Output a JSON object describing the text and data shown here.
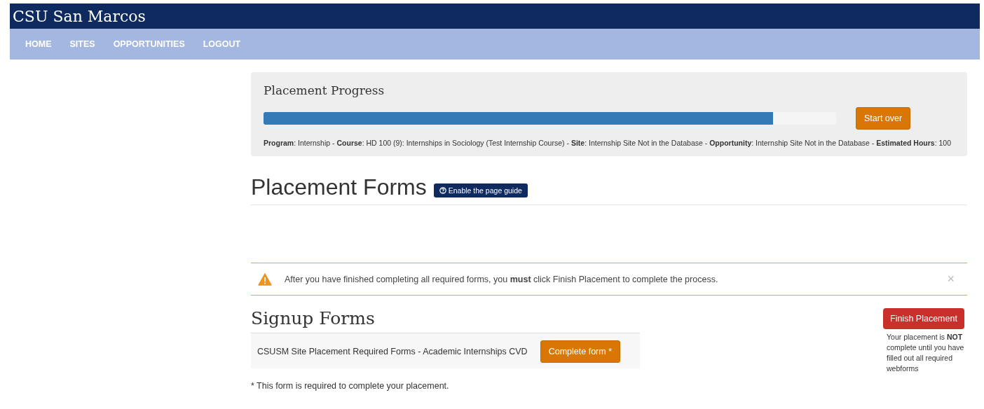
{
  "header": {
    "title": "CSU San Marcos"
  },
  "nav": [
    {
      "label": "HOME"
    },
    {
      "label": "SITES"
    },
    {
      "label": "OPPORTUNITIES"
    },
    {
      "label": "LOGOUT"
    }
  ],
  "progress": {
    "title": "Placement Progress",
    "level": 0.89,
    "button": "Start over",
    "summary": "**Program**: Internship - **Course**: HD 100 (9): Internships in Sociology (Test Internship Course) - **Site**: Internship Site Not in the Database - **Opportunity**: Internship Site Not in the Database - **Estimated Hours**: 100"
  },
  "forms_heading": {
    "title": "Placement Forms",
    "guide_button": "Enable the page guide"
  },
  "alert": {
    "text": "After you have finished completing all required forms, you **must** click Finish Placement to complete the process.",
    "close": "×"
  },
  "signup": {
    "title": "Signup Forms",
    "rows": [
      {
        "name": "CSUSM Site Placement Required Forms - Academic Internships CVD",
        "button": "Complete form *"
      }
    ],
    "footnote": "* This form is required to complete your placement."
  },
  "finish": {
    "button": "Finish Placement",
    "note": "Your placement is **NOT** complete until you have filled out all required webforms"
  }
}
